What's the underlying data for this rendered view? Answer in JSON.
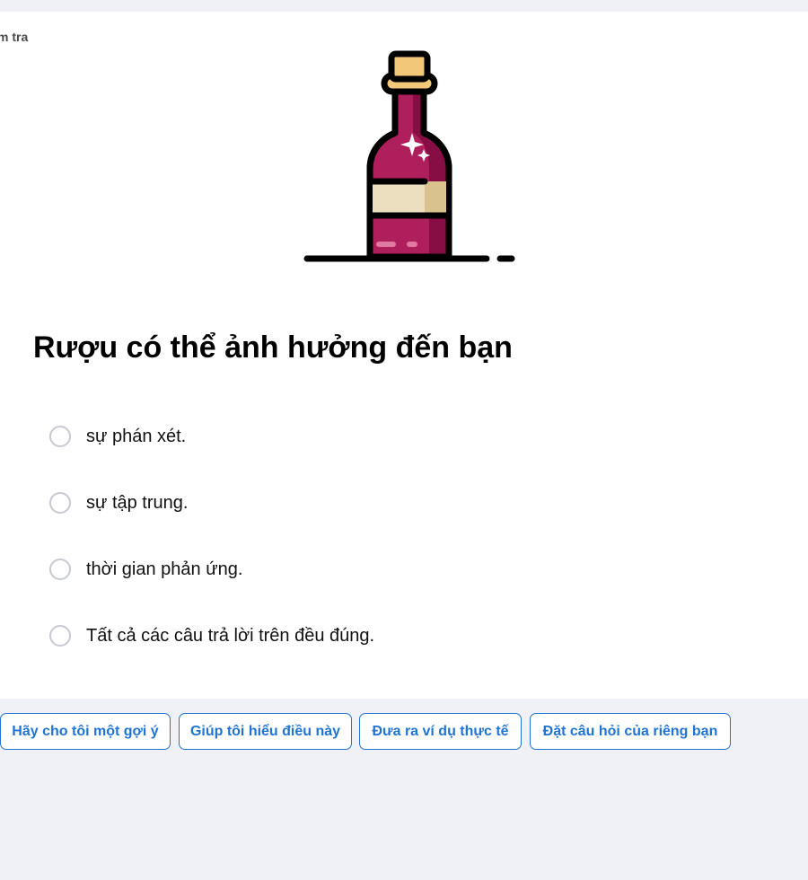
{
  "header": {
    "crumb": "m tra"
  },
  "illustration": {
    "icon": "wine-bottle-icon",
    "colors": {
      "bottle": "#ae1f5c",
      "bottle_shade": "#870e44",
      "label": "#ebdfc0",
      "label_shade": "#d9c28e",
      "cork": "#f3c77a",
      "outline": "#000000",
      "sparkle": "#ffffff",
      "highlight": "#e07aa1"
    }
  },
  "question": {
    "title": "Rượu có thể ảnh hưởng đến bạn"
  },
  "options": [
    {
      "label": "sự phán xét."
    },
    {
      "label": "sự tập trung."
    },
    {
      "label": "thời gian phản ứng."
    },
    {
      "label": "Tất cả các câu trả lời trên đều đúng."
    }
  ],
  "chips": [
    {
      "label": "Hãy cho tôi một gợi ý"
    },
    {
      "label": "Giúp tôi hiểu điều này"
    },
    {
      "label": "Đưa ra ví dụ thực tế"
    },
    {
      "label": "Đặt câu hỏi của riêng bạn"
    }
  ],
  "theme": {
    "page_bg": "#f0f1f6",
    "card_bg": "#ffffff",
    "accent": "#1f74d4",
    "radio_border": "#c7c9d3"
  }
}
